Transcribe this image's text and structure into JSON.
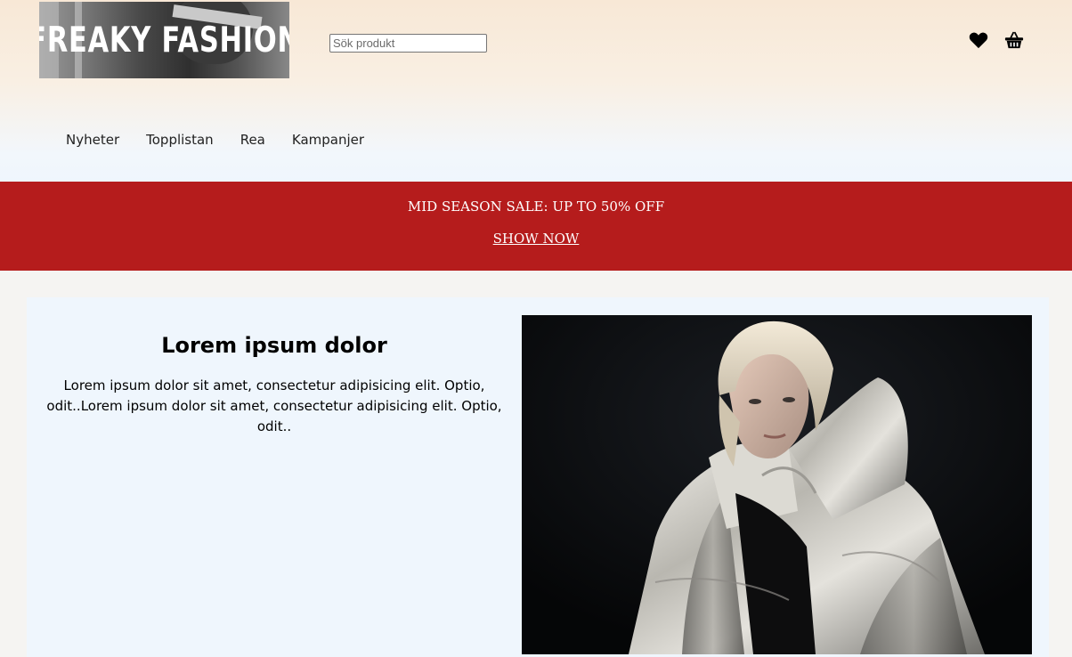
{
  "header": {
    "logo_text": "FREAKY FASHION",
    "search": {
      "placeholder": "Sök produkt",
      "value": ""
    },
    "icons": [
      "heart-icon",
      "basket-icon"
    ]
  },
  "nav": {
    "items": [
      {
        "label": "Nyheter"
      },
      {
        "label": "Topplistan"
      },
      {
        "label": "Rea"
      },
      {
        "label": "Kampanjer"
      }
    ]
  },
  "banner": {
    "title": "MID SEASON SALE: UP TO 50% OFF",
    "link_label": "SHOW NOW",
    "color": "#b51c1c"
  },
  "hero": {
    "title": "Lorem ipsum dolor",
    "body": "Lorem ipsum dolor sit amet, consectetur adipisicing elit. Optio, odit..Lorem ipsum dolor sit amet, consectetur adipisicing elit. Optio, odit.."
  }
}
